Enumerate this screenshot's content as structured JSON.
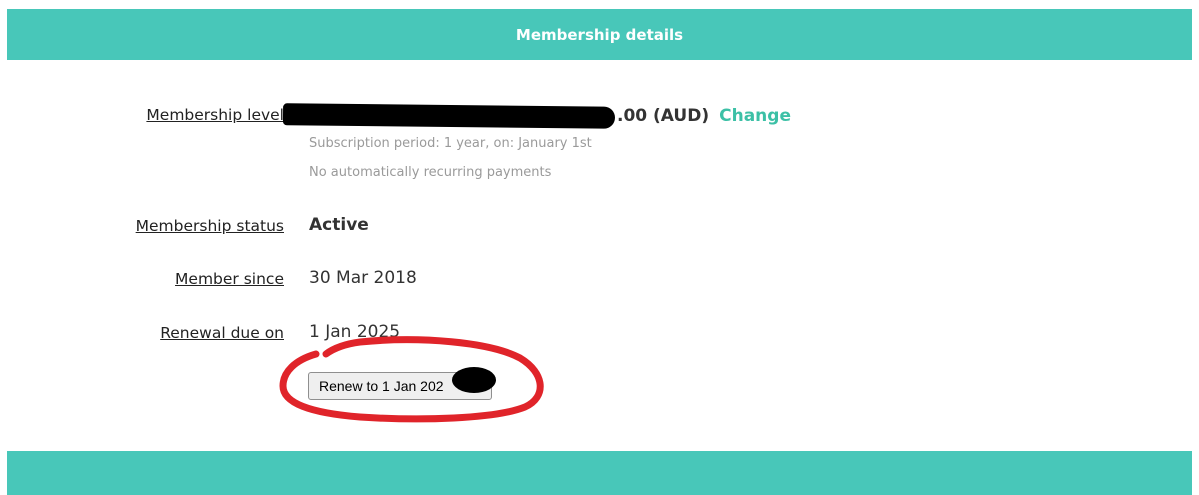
{
  "header": {
    "title": "Membership details"
  },
  "fields": {
    "level": {
      "label": "Membership level",
      "price_visible": ".00 (AUD)",
      "change_label": "Change",
      "notes": [
        "Subscription period: 1 year, on: January 1st",
        "No automatically recurring payments"
      ]
    },
    "status": {
      "label": "Membership status",
      "value": "Active"
    },
    "since": {
      "label": "Member since",
      "value": "30 Mar 2018"
    },
    "renewal": {
      "label": "Renewal due on",
      "value": "1 Jan 2025"
    }
  },
  "renew_button": {
    "label": "Renew to 1 Jan 202"
  },
  "colors": {
    "accent": "#48c7b9",
    "link": "#3cc0a6",
    "annotation": "#e0242a",
    "redaction": "#000000"
  }
}
